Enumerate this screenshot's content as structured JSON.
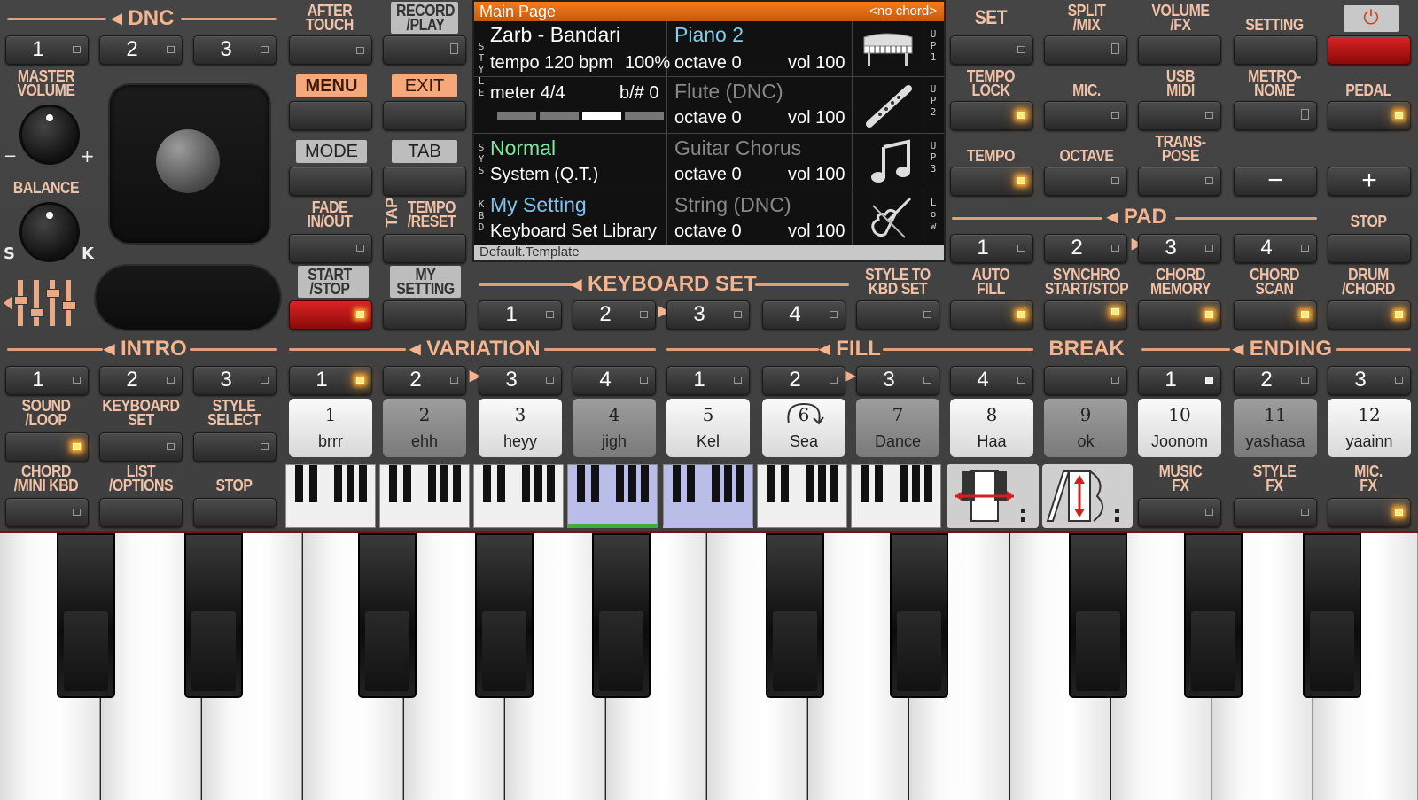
{
  "colors": {
    "accent": "#f3b48f",
    "display_title": "#f47a1e",
    "style_name": "#ffffff",
    "upper_voice": "#7fd0f0",
    "sys_green": "#7fe6a0",
    "kbd_blue": "#7fb8e8"
  },
  "dnc": {
    "title": "DNC",
    "buttons": [
      "1",
      "2",
      "3"
    ]
  },
  "after_touch": {
    "label": "AFTER\nTOUCH"
  },
  "record_play": {
    "label": "RECORD\n/PLAY"
  },
  "master_volume": {
    "label": "MASTER\nVOLUME",
    "minus": "−",
    "plus": "+"
  },
  "balance": {
    "label": "BALANCE",
    "left": "S",
    "right": "K"
  },
  "menu": {
    "label": "MENU"
  },
  "exit": {
    "label": "EXIT"
  },
  "mode": {
    "label": "MODE"
  },
  "tab": {
    "label": "TAB"
  },
  "fade": {
    "label": "FADE\nIN/OUT"
  },
  "tap": {
    "label": "TAP",
    "tempo_reset": "TEMPO\n/RESET"
  },
  "start_stop": {
    "label": "START\n/STOP"
  },
  "my_setting": {
    "label": "MY\nSETTING"
  },
  "display": {
    "title": "Main Page",
    "chord": "<no chord>",
    "style": {
      "side": "S\nT\nY\nL\nE",
      "name": "Zarb - Bandari",
      "tempo": "tempo 120 bpm",
      "percent": "100%",
      "meter": "meter 4/4",
      "bsharp": "b/# 0"
    },
    "sys": {
      "side": "S\nY\nS",
      "name": "Normal",
      "sub": "System (Q.T.)"
    },
    "kbd": {
      "side": "K\nB\nD",
      "name": "My Setting",
      "sub": "Keyboard Set Library"
    },
    "voices": [
      {
        "name": "Piano 2",
        "octave": "octave  0",
        "vol": "vol 100",
        "side": "U\nP\n1",
        "icon": "piano-icon"
      },
      {
        "name": "Flute (DNC)",
        "octave": "octave  0",
        "vol": "vol 100",
        "side": "U\nP\n2",
        "icon": "flute-icon"
      },
      {
        "name": "Guitar Chorus",
        "octave": "octave  0",
        "vol": "vol 100",
        "side": "U\nP\n3",
        "icon": "music-note-icon"
      },
      {
        "name": "String (DNC)",
        "octave": "octave  0",
        "vol": "vol 100",
        "side": "L\no\nw",
        "icon": "violin-icon"
      }
    ],
    "footer": "Default.Template"
  },
  "right": {
    "set": "SET",
    "split_mix": "SPLIT\n/MIX",
    "volume_fx": "VOLUME\n/FX",
    "setting": "SETTING",
    "power": "⏻",
    "tempo_lock": "TEMPO\nLOCK",
    "mic": "MIC.",
    "usb_midi": "USB\nMIDI",
    "metronome": "METRO-\nNOME",
    "pedal": "PEDAL",
    "tempo": "TEMPO",
    "octave": "OCTAVE",
    "transpose": "TRANS-\nPOSE",
    "minus": "−",
    "plus": "+",
    "pad_title": "PAD",
    "pad_buttons": [
      "1",
      "2",
      "3",
      "4"
    ],
    "stop": "STOP",
    "auto_fill": "AUTO\nFILL",
    "synchro": "SYNCHRO\nSTART/STOP",
    "chord_memory": "CHORD\nMEMORY",
    "chord_scan": "CHORD\nSCAN",
    "drum_chord": "DRUM\n/CHORD"
  },
  "keyboard_set": {
    "title": "KEYBOARD SET",
    "buttons": [
      "1",
      "2",
      "3",
      "4"
    ],
    "style_to_kbd": "STYLE TO\nKBD SET"
  },
  "intro": {
    "title": "INTRO",
    "buttons": [
      "1",
      "2",
      "3"
    ]
  },
  "variation": {
    "title": "VARIATION",
    "buttons": [
      "1",
      "2",
      "3",
      "4"
    ]
  },
  "fill": {
    "title": "FILL",
    "buttons": [
      "1",
      "2",
      "3",
      "4"
    ]
  },
  "break": {
    "title": "BREAK"
  },
  "ending": {
    "title": "ENDING",
    "buttons": [
      "1",
      "2",
      "3"
    ]
  },
  "left_bottom": {
    "sound_loop": "SOUND\n/LOOP",
    "keyboard_set": "KEYBOARD\nSET",
    "style_select": "STYLE\nSELECT",
    "chord_mini": "CHORD\n/MINI KBD",
    "list_options": "LIST\n/OPTIONS",
    "stop": "STOP"
  },
  "pads": [
    {
      "num": "1",
      "label": "brrr"
    },
    {
      "num": "2",
      "label": "ehh"
    },
    {
      "num": "3",
      "label": "heyy"
    },
    {
      "num": "4",
      "label": "jigh"
    },
    {
      "num": "5",
      "label": "Kel"
    },
    {
      "num": "6",
      "label": "Sea"
    },
    {
      "num": "7",
      "label": "Dance"
    },
    {
      "num": "8",
      "label": "Haa"
    },
    {
      "num": "9",
      "label": "ok"
    },
    {
      "num": "10",
      "label": "Joonom"
    },
    {
      "num": "11",
      "label": "yashasa"
    },
    {
      "num": "12",
      "label": "yaainn"
    }
  ],
  "fx": {
    "music": "MUSIC\nFX",
    "style": "STYLE\nFX",
    "mic": "MIC.\nFX"
  }
}
